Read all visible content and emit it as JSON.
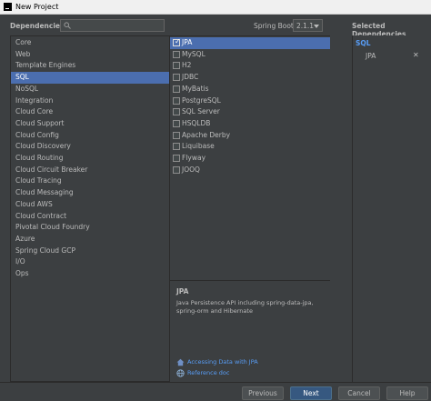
{
  "window": {
    "title": "New Project"
  },
  "header": {
    "dependencies_label": "Dependencies",
    "search": {
      "value": "",
      "placeholder": ""
    },
    "spring_boot_label": "Spring Boot",
    "spring_boot_version": "2.1.1",
    "selected_label": "Selected Dependencies"
  },
  "categories": [
    "Core",
    "Web",
    "Template Engines",
    "SQL",
    "NoSQL",
    "Integration",
    "Cloud Core",
    "Cloud Support",
    "Cloud Config",
    "Cloud Discovery",
    "Cloud Routing",
    "Cloud Circuit Breaker",
    "Cloud Tracing",
    "Cloud Messaging",
    "Cloud AWS",
    "Cloud Contract",
    "Pivotal Cloud Foundry",
    "Azure",
    "Spring Cloud GCP",
    "I/O",
    "Ops"
  ],
  "selected_category": "SQL",
  "dependencies": [
    {
      "label": "JPA",
      "checked": true
    },
    {
      "label": "MySQL",
      "checked": false
    },
    {
      "label": "H2",
      "checked": false
    },
    {
      "label": "JDBC",
      "checked": false
    },
    {
      "label": "MyBatis",
      "checked": false
    },
    {
      "label": "PostgreSQL",
      "checked": false
    },
    {
      "label": "SQL Server",
      "checked": false
    },
    {
      "label": "HSQLDB",
      "checked": false
    },
    {
      "label": "Apache Derby",
      "checked": false
    },
    {
      "label": "Liquibase",
      "checked": false
    },
    {
      "label": "Flyway",
      "checked": false
    },
    {
      "label": "JOOQ",
      "checked": false
    }
  ],
  "description": {
    "title": "JPA",
    "text": "Java Persistence API including spring-data-jpa, spring-orm and Hibernate",
    "links": [
      {
        "label": "Accessing Data with JPA",
        "icon": "home-icon"
      },
      {
        "label": "Reference doc",
        "icon": "globe-icon"
      }
    ]
  },
  "selected": {
    "group": "SQL",
    "items": [
      {
        "label": "JPA",
        "remove": "✕"
      }
    ]
  },
  "footer": {
    "previous": "Previous",
    "next": "Next",
    "cancel": "Cancel",
    "help": "Help"
  },
  "colors": {
    "background": "#3c3f41",
    "selection": "#4b6eaf",
    "link": "#589df6",
    "default_button": "#365880"
  }
}
